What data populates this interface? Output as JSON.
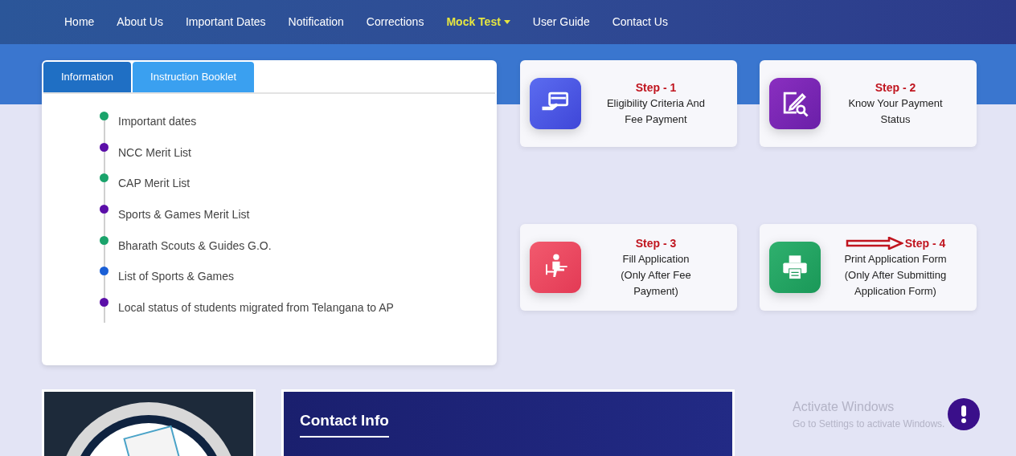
{
  "nav": {
    "items": [
      {
        "label": "Home",
        "selected": false,
        "dropdown": false
      },
      {
        "label": "About Us",
        "selected": false,
        "dropdown": false
      },
      {
        "label": "Important Dates",
        "selected": false,
        "dropdown": false
      },
      {
        "label": "Notification",
        "selected": false,
        "dropdown": false
      },
      {
        "label": "Corrections",
        "selected": false,
        "dropdown": false
      },
      {
        "label": "Mock Test",
        "selected": true,
        "dropdown": true
      },
      {
        "label": "User Guide",
        "selected": false,
        "dropdown": false
      },
      {
        "label": "Contact Us",
        "selected": false,
        "dropdown": false
      }
    ]
  },
  "info_panel": {
    "tabs": [
      {
        "label": "Information",
        "selected": true
      },
      {
        "label": "Instruction Booklet",
        "selected": false
      }
    ],
    "items": [
      {
        "text": "Important dates",
        "color": "#1aa36b"
      },
      {
        "text": "NCC Merit List",
        "color": "#5b0fa8"
      },
      {
        "text": "CAP Merit List",
        "color": "#1aa36b"
      },
      {
        "text": "Sports & Games Merit List",
        "color": "#5b0fa8"
      },
      {
        "text": "Bharath Scouts & Guides G.O.",
        "color": "#1aa36b"
      },
      {
        "text": "List of Sports & Games",
        "color": "#1a5fd6"
      },
      {
        "text": "Local status of students migrated from Telangana to AP",
        "color": "#5b0fa8"
      }
    ]
  },
  "steps": [
    {
      "kind": "payment",
      "step": "Step - 1",
      "lines": [
        "Eligibility Criteria And",
        "Fee Payment"
      ],
      "arrow": false
    },
    {
      "kind": "search",
      "step": "Step - 2",
      "lines": [
        "Know Your Payment",
        "Status"
      ],
      "arrow": false
    },
    {
      "kind": "student",
      "step": "Step - 3",
      "lines": [
        "Fill Application",
        "(Only After Fee",
        "Payment)"
      ],
      "arrow": false
    },
    {
      "kind": "printer",
      "step": "Step - 4",
      "lines": [
        "Print Application Form",
        "(Only After Submitting",
        "Application Form)"
      ],
      "arrow": true
    }
  ],
  "contact": {
    "title": "Contact Info"
  },
  "activation": {
    "title": "Activate Windows",
    "subtitle": "Go to Settings to activate Windows."
  }
}
